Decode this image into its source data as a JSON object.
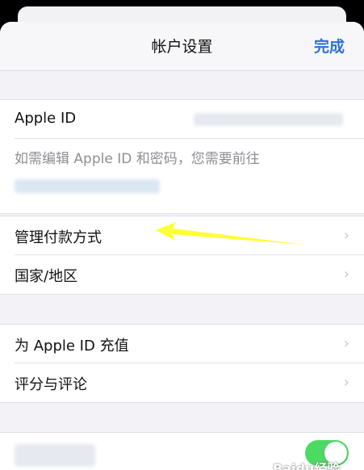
{
  "nav": {
    "title": "帐户设置",
    "done_label": "完成"
  },
  "account": {
    "apple_id_label": "Apple ID",
    "note": "如需编辑 Apple ID 和密码，您需要前往"
  },
  "payment_group": {
    "items": [
      {
        "label": "管理付款方式"
      },
      {
        "label": "国家/地区"
      }
    ]
  },
  "apple_id_group": {
    "items": [
      {
        "label": "为 Apple ID 充值"
      },
      {
        "label": "评分与评论"
      }
    ]
  },
  "annotation": {
    "arrow_color": "#ffff33"
  },
  "colors": {
    "accent": "#2b72d9",
    "toggle_on": "#4cd964"
  },
  "watermark": "Baidu经验",
  "toggle": {
    "on": true
  },
  "icons": {
    "chevron": "chevron-right-icon"
  }
}
